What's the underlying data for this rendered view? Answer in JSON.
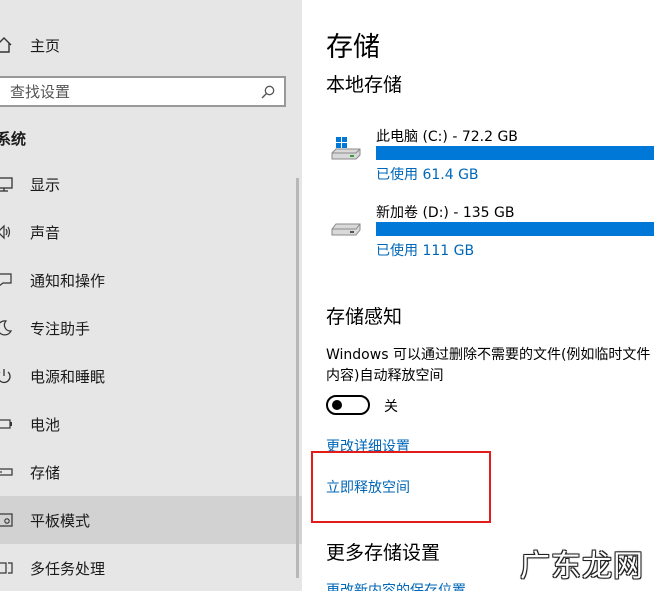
{
  "sidebar": {
    "home_label": "主页",
    "search": {
      "placeholder": "查找设置"
    },
    "section_heading": "系统",
    "items": [
      {
        "label": "显示",
        "icon": "monitor-icon"
      },
      {
        "label": "声音",
        "icon": "speaker-icon"
      },
      {
        "label": "通知和操作",
        "icon": "notification-icon"
      },
      {
        "label": "专注助手",
        "icon": "moon-icon"
      },
      {
        "label": "电源和睡眠",
        "icon": "power-icon"
      },
      {
        "label": "电池",
        "icon": "battery-icon"
      },
      {
        "label": "存储",
        "icon": "storage-icon"
      },
      {
        "label": "平板模式",
        "icon": "tablet-icon",
        "active": true
      },
      {
        "label": "多任务处理",
        "icon": "multitask-icon"
      }
    ]
  },
  "main": {
    "title": "存储",
    "local_storage_heading": "本地存储",
    "drives": [
      {
        "name": "此电脑 (C:) - 72.2 GB",
        "used": "已使用 61.4 GB",
        "used_fraction": 0.85,
        "icon": "windows-drive-icon"
      },
      {
        "name": "新加卷 (D:) - 135 GB",
        "used": "已使用 111 GB",
        "used_fraction": 0.82,
        "icon": "drive-icon"
      }
    ],
    "storage_sense_heading": "存储感知",
    "storage_sense_desc_line1": "Windows 可以通过删除不需要的文件(例如临时文件",
    "storage_sense_desc_line2": "内容)自动释放空间",
    "toggle_state": "关",
    "change_settings_link": "更改详细设置",
    "free_space_link": "立即释放空间",
    "more_settings_heading": "更多存储设置",
    "save_location_link": "更改新内容的保存位置"
  },
  "overlay": {
    "watermark": "广东龙网",
    "highlight_color": "#e21b1b"
  },
  "colors": {
    "sidebar_bg": "#e6e6e6",
    "accent": "#0078d7",
    "link": "#0067b8"
  }
}
